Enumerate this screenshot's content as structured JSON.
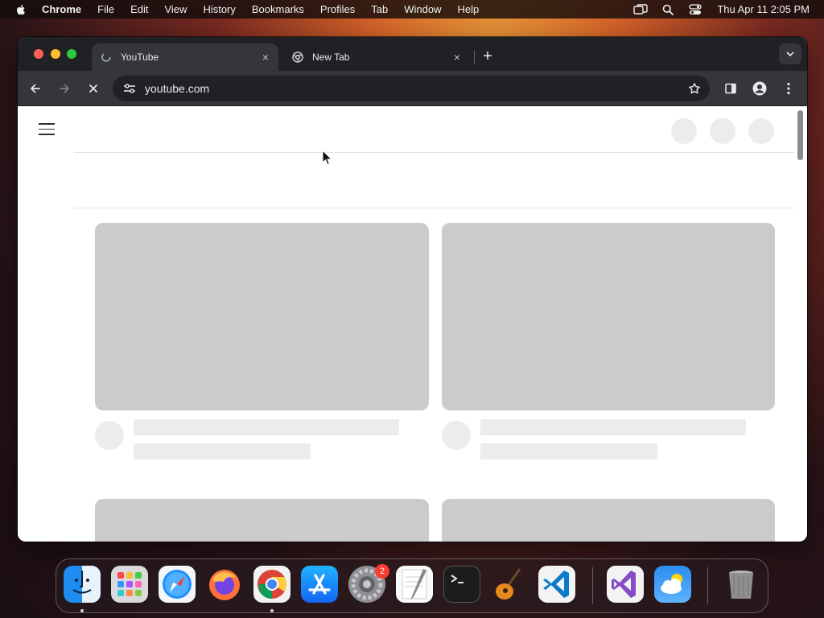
{
  "menubar": {
    "app_name": "Chrome",
    "items": [
      "File",
      "Edit",
      "View",
      "History",
      "Bookmarks",
      "Profiles",
      "Tab",
      "Window",
      "Help"
    ],
    "clock": "Thu Apr 11  2:05 PM",
    "status_icons": [
      "screen-mirroring-icon",
      "spotlight-search-icon",
      "control-center-icon"
    ]
  },
  "browser": {
    "tabs": [
      {
        "title": "YouTube",
        "active": true,
        "favicon": "loading-icon"
      },
      {
        "title": "New Tab",
        "active": false,
        "favicon": "chrome-icon"
      }
    ],
    "new_tab_symbol": "+",
    "close_symbol": "×",
    "url": "youtube.com",
    "loading": true
  },
  "dock": {
    "apps": [
      "Finder",
      "Launchpad",
      "Safari",
      "Firefox",
      "Google Chrome",
      "App Store",
      "System Settings",
      "TextEdit",
      "Terminal",
      "GarageBand",
      "Visual Studio Code",
      "Visual Studio",
      "Weather",
      "Trash"
    ],
    "system_settings_badge": "2"
  },
  "colors": {
    "chrome_dark": "#202124",
    "chrome_toolbar": "#35363a",
    "skeleton": "#cbcbcb",
    "skeleton_light": "#ececec"
  }
}
